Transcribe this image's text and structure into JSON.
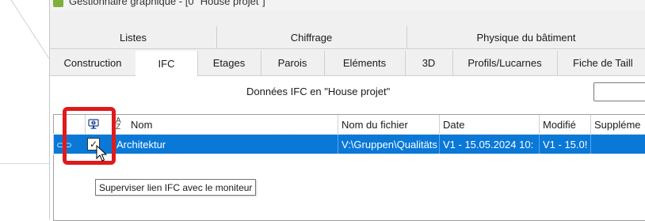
{
  "window": {
    "title": "Gestionnaire graphique - [0 \"House projet\"]"
  },
  "tabs_row1": [
    {
      "label": "Listes"
    },
    {
      "label": "Chiffrage"
    },
    {
      "label": "Physique du bâtiment"
    }
  ],
  "tabs_row2": [
    {
      "label": "Construction",
      "active": false
    },
    {
      "label": "IFC",
      "active": true
    },
    {
      "label": "Etages",
      "active": false
    },
    {
      "label": "Parois",
      "active": false
    },
    {
      "label": "Eléments",
      "active": false
    },
    {
      "label": "3D",
      "active": false
    },
    {
      "label": "Profils/Lucarnes",
      "active": false
    },
    {
      "label": "Fiche de Taill",
      "active": false
    }
  ],
  "ifc_panel": {
    "title": "Données IFC en \"House projet\"",
    "columns": {
      "nom": "Nom",
      "fichier": "Nom du fichier",
      "date": "Date",
      "modifie": "Modifié",
      "supplement": "Suppléme"
    },
    "rows": [
      {
        "checked": true,
        "check_glyph": "✓",
        "nom": "Architektur",
        "fichier": "V:\\Gruppen\\Qualitäts",
        "date": "V1 - 15.05.2024  10:",
        "modifie": "V1 - 15.0!",
        "supplement": ""
      }
    ],
    "tooltip": "Superviser lien IFC avec le moniteur"
  },
  "icons": {
    "monitor": "monitor-icon",
    "sort": "sort-az-icon",
    "link": "link-icon",
    "cursor": "mouse-cursor-icon",
    "app": "app-icon"
  },
  "colors": {
    "selection": "#0a78d7",
    "highlight": "#e01a1a",
    "app_icon": "#7fb03a"
  }
}
